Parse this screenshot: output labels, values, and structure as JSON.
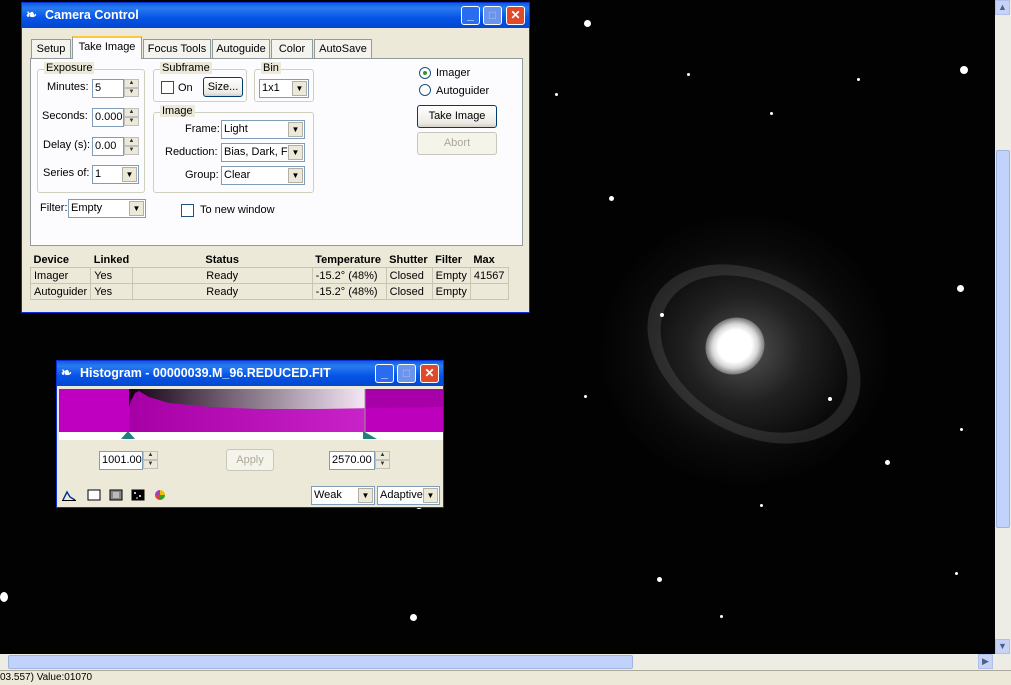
{
  "colors": {
    "title_blue": "#0554e6",
    "histogram_magenta": "#c000c0",
    "face": "#ece9d8"
  },
  "camera": {
    "title": "Camera Control",
    "tabs": [
      "Setup",
      "Take Image",
      "Focus Tools",
      "Autoguide",
      "Color",
      "AutoSave"
    ],
    "active_tab": "Take Image",
    "exposure": {
      "group": "Exposure",
      "minutes_label": "Minutes:",
      "minutes": "5",
      "seconds_label": "Seconds:",
      "seconds": "0.000",
      "delay_label": "Delay (s):",
      "delay": "0.00",
      "series_label": "Series of:",
      "series": "1"
    },
    "subframe": {
      "group": "Subframe",
      "on_label": "On",
      "size_button": "Size..."
    },
    "bin": {
      "group": "Bin",
      "value": "1x1"
    },
    "image": {
      "group": "Image",
      "frame_label": "Frame:",
      "frame": "Light",
      "reduction_label": "Reduction:",
      "reduction": "Bias, Dark, F",
      "group_label": "Group:",
      "group_value": "Clear"
    },
    "filter_label": "Filter:",
    "filter": "Empty",
    "new_window_label": "To new window",
    "imager_radio": "Imager",
    "autoguider_radio": "Autoguider",
    "take_image_button": "Take Image",
    "abort_button": "Abort",
    "table": {
      "headers": [
        "Device",
        "Linked",
        "Status",
        "Temperature",
        "Shutter",
        "Filter",
        "Max"
      ],
      "rows": [
        [
          "Imager",
          "Yes",
          "Ready",
          "-15.2° (48%)",
          "Closed",
          "Empty",
          "41567"
        ],
        [
          "Autoguider",
          "Yes",
          "Ready",
          "-15.2° (48%)",
          "Closed",
          "Empty",
          ""
        ]
      ]
    }
  },
  "histogram": {
    "title": "Histogram - 00000039.M_96.REDUCED.FIT",
    "low": "1001.00",
    "high": "2570.00",
    "apply_button": "Apply",
    "stretch": "Weak",
    "mode": "Adaptive"
  },
  "status_text": "03.557) Value:01070"
}
